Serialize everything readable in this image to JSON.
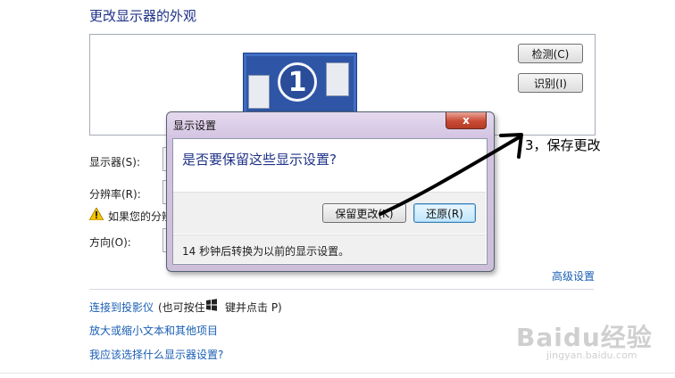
{
  "page": {
    "title": "更改显示器的外观",
    "detect_label": "检测(C)",
    "identify_label": "识别(I)",
    "monitor_number": "1",
    "display_label": "显示器(S):",
    "resolution_label": "分辨率(R):",
    "warning_text": "如果您的分辨",
    "orientation_label": "方向(O):",
    "advanced_link": "高级设置",
    "side_note": "3，保存更改",
    "links": {
      "projector": "连接到投影仪",
      "projector_hint_pre": "(也可按住",
      "projector_hint_post": "键并点击 P)",
      "text_size": "放大或缩小文本和其他项目",
      "which_settings": "我应该选择什么显示器设置?"
    }
  },
  "dialog": {
    "title": "显示设置",
    "close_glyph": "x",
    "question": "是否要保留这些显示设置?",
    "keep_label": "保留更改(K)",
    "revert_label": "还原(R)",
    "countdown_text": "14 秒钟后转换为以前的显示设置。"
  },
  "watermark": {
    "logo": "Baidu经验",
    "url": "jingyan.baidu.com"
  },
  "icons": [
    "warning-icon",
    "windows-key-icon",
    "close-icon"
  ],
  "colors": {
    "heading": "#1e3287",
    "link": "#1a5fb4",
    "dialog_frame": "#d3c3e2",
    "close_button": "#c94a34",
    "monitor": "#2f56a6"
  }
}
